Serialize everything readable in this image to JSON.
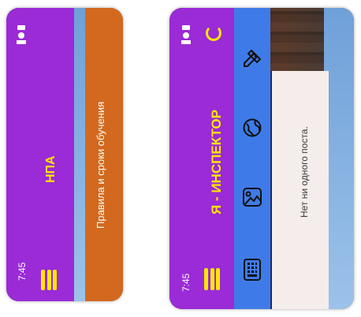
{
  "left_screen": {
    "time": "7:45",
    "title": "НПА",
    "banner": "Правила и сроки обучения",
    "colors": {
      "header": "#9a2bd6",
      "banner": "#d2691e",
      "title": "#ffe600"
    }
  },
  "right_screen": {
    "time": "7:45",
    "title": "Я - ИНСПЕКТОР",
    "empty_message": "Нет ни одного поста.",
    "tab_icons": [
      "keyboard-icon",
      "image-icon",
      "globe-icon",
      "pencil-ruler-icon"
    ],
    "colors": {
      "header": "#9a2bd6",
      "tabs": "#3f7be8",
      "accent": "#ffe600"
    }
  }
}
